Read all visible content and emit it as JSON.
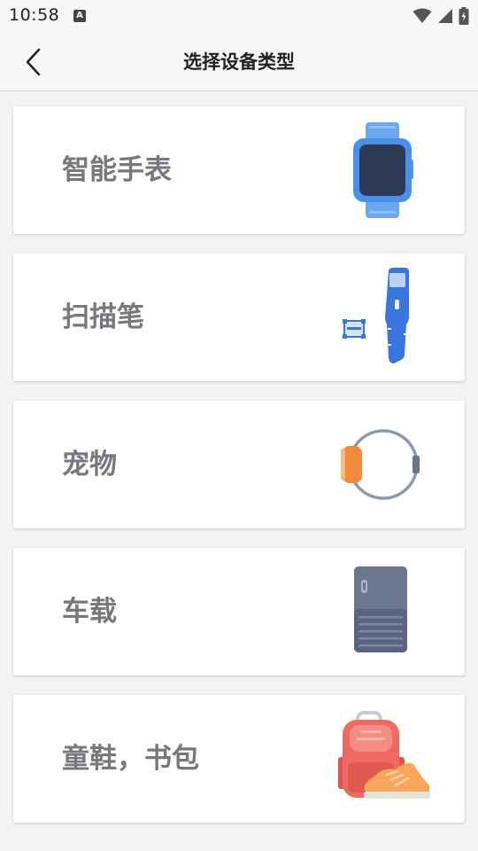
{
  "status_bar": {
    "time": "10:58",
    "notification_icon_text": "A",
    "icons": [
      "wifi-icon",
      "cellular-signal-icon",
      "battery-charging-icon"
    ]
  },
  "header": {
    "title": "选择设备类型",
    "back_icon": "chevron-left-icon"
  },
  "devices": [
    {
      "label": "智能手表",
      "icon": "smartwatch-icon"
    },
    {
      "label": "扫描笔",
      "icon": "scan-pen-icon"
    },
    {
      "label": "宠物",
      "icon": "pet-collar-icon"
    },
    {
      "label": "车载",
      "icon": "vehicle-device-icon"
    },
    {
      "label": "童鞋，书包",
      "icon": "schoolbag-shoe-icon"
    }
  ],
  "colors": {
    "watch_blue": "#4a90e8",
    "watch_screen": "#2d3a58",
    "pen_blue": "#3b75e0",
    "collar_orange": "#f28a3c",
    "collar_ring": "#8d97ad",
    "vehicle_gray": "#6b768f",
    "bag_red": "#ee6a60",
    "shoe_orange": "#f7a65a"
  }
}
